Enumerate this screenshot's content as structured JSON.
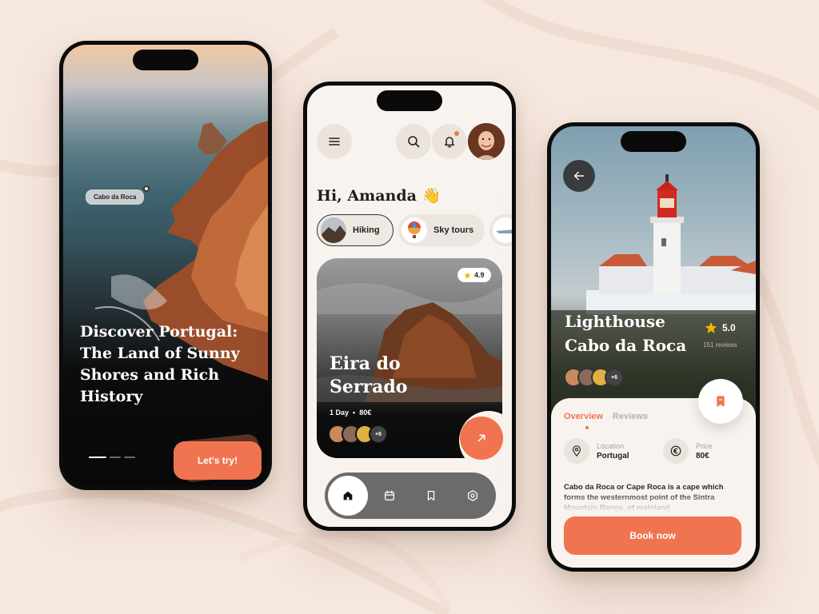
{
  "colors": {
    "accent": "#f0744f",
    "background": "#f6e8df",
    "screen": "#f8f3ee",
    "dark": "#0c0c0c"
  },
  "onboarding": {
    "location_tag": "Cabo da Roca",
    "title": "Discover Portugal: The Land of Sunny Shores and Rich History",
    "cta_label": "Let's try!",
    "pagination": {
      "total": 3,
      "active": 1
    }
  },
  "home": {
    "greeting": "Hi, Amanda 👋",
    "header_icons": [
      "menu-icon",
      "search-icon",
      "bell-icon"
    ],
    "categories": [
      {
        "label": "Hiking",
        "active": true
      },
      {
        "label": "Sky tours",
        "active": false
      },
      {
        "label": "",
        "active": false
      }
    ],
    "card": {
      "title": "Eira do Serrado",
      "rating": "4.9",
      "duration": "1 Day",
      "separator": "•",
      "price": "80€",
      "extra_count": "+6"
    },
    "nav_icons": [
      "home-icon",
      "calendar-icon",
      "bookmark-icon",
      "settings-icon"
    ]
  },
  "detail": {
    "title": "Lighthouse Cabo da Roca",
    "rating": "5.0",
    "reviews": "151 reviews",
    "extra_count": "+6",
    "tabs": {
      "overview": "Overview",
      "reviews": "Reviews"
    },
    "location": {
      "label": "Location",
      "value": "Portugal"
    },
    "price": {
      "label": "Price",
      "value": "80€"
    },
    "description": "Cabo da Roca or Cape Roca is a cape which forms the westernmost point of the Sintra Mountain Range, of mainland",
    "book_label": "Book now"
  }
}
